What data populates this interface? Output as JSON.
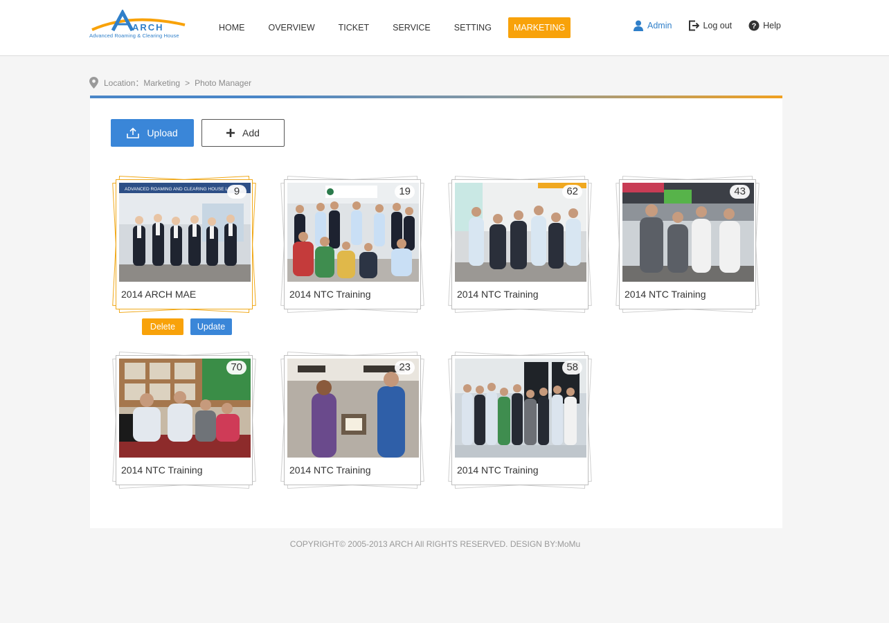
{
  "header": {
    "logo_text": "ARCH",
    "logo_tagline": "Advanced Roaming & Clearing House",
    "nav": [
      {
        "label": "HOME",
        "active": false
      },
      {
        "label": "OVERVIEW",
        "active": false
      },
      {
        "label": "TICKET",
        "active": false
      },
      {
        "label": "SERVICE",
        "active": false
      },
      {
        "label": "SETTING",
        "active": false
      },
      {
        "label": "MARKETING",
        "active": true
      }
    ],
    "user": {
      "admin_label": "Admin",
      "logout_label": "Log out",
      "help_label": "Help"
    }
  },
  "breadcrumb": {
    "prefix": "Location：",
    "items": [
      "Marketing",
      "Photo Manager"
    ],
    "separator": ">"
  },
  "toolbar": {
    "upload_label": "Upload",
    "add_label": "Add"
  },
  "albums": [
    {
      "title": "2014 ARCH MAE",
      "count": "9",
      "selected": true,
      "banner": "ADVANCED ROAMING AND CLEARING HOUSE LIMITED"
    },
    {
      "title": "2014 NTC Training",
      "count": "19",
      "selected": false
    },
    {
      "title": "2014 NTC Training",
      "count": "62",
      "selected": false
    },
    {
      "title": "2014 NTC Training",
      "count": "43",
      "selected": false
    },
    {
      "title": "2014 NTC Training",
      "count": "70",
      "selected": false
    },
    {
      "title": "2014 NTC Training",
      "count": "23",
      "selected": false
    },
    {
      "title": "2014 NTC Training",
      "count": "58",
      "selected": false
    }
  ],
  "album_actions": {
    "delete_label": "Delete",
    "update_label": "Update"
  },
  "footer": {
    "copyright": "COPYRIGHT© 2005-2013 ARCH All RIGHTS RESERVED. DESIGN BY:MoMu"
  },
  "colors": {
    "accent_orange": "#f8a20a",
    "accent_blue": "#3a86d8",
    "link_blue": "#2f7fc9",
    "selected_border": "#f0a818"
  },
  "icons": {
    "user": "user-icon",
    "logout": "logout-icon",
    "help": "help-icon",
    "location": "location-pin-icon",
    "upload": "upload-icon",
    "add": "plus-icon"
  }
}
